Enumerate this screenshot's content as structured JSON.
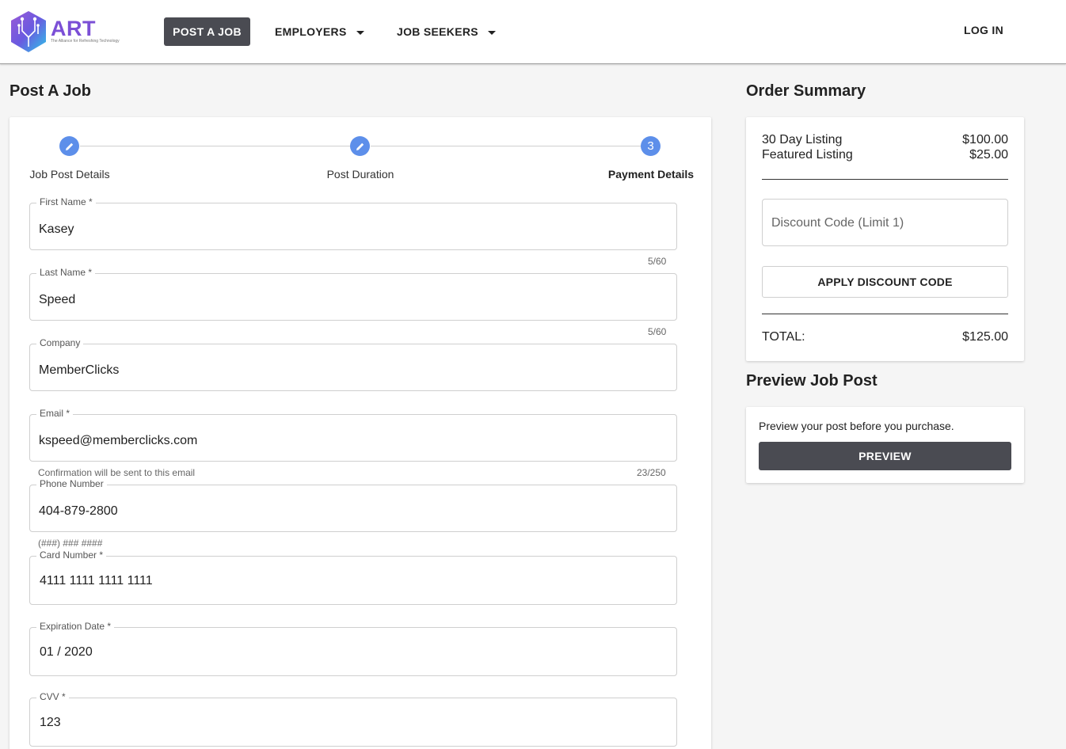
{
  "header": {
    "logo_text": "ART",
    "logo_tagline": "The Alliance for Refreshing Technology",
    "nav": {
      "post_job": "POST A JOB",
      "employers": "EMPLOYERS",
      "job_seekers": "JOB SEEKERS",
      "login": "LOG IN"
    }
  },
  "page_title": "Post A Job",
  "stepper": {
    "steps": [
      {
        "label": "Job Post Details",
        "icon": "pencil-icon"
      },
      {
        "label": "Post Duration",
        "icon": "pencil-icon"
      },
      {
        "label": "Payment Details",
        "number": "3"
      }
    ]
  },
  "form": {
    "first_name": {
      "label": "First Name  *",
      "value": "Kasey",
      "counter": "5/60"
    },
    "last_name": {
      "label": "Last Name  *",
      "value": "Speed",
      "counter": "5/60"
    },
    "company": {
      "label": "Company",
      "value": "MemberClicks"
    },
    "email": {
      "label": "Email  *",
      "value": "kspeed@memberclicks.com",
      "hint": "Confirmation will be sent to this email",
      "counter": "23/250"
    },
    "phone": {
      "label": "Phone Number",
      "value": "404-879-2800",
      "hint": "(###) ### ####"
    },
    "card_number": {
      "label": "Card Number *",
      "value": "4111 1111 1111 1111"
    },
    "expiration": {
      "label": "Expiration Date *",
      "value": "01 / 2020"
    },
    "cvv": {
      "label": "CVV *",
      "value": "123"
    }
  },
  "order_summary": {
    "title": "Order Summary",
    "items": [
      {
        "name": "30 Day Listing",
        "price": "$100.00"
      },
      {
        "name": "Featured Listing",
        "price": "$25.00"
      }
    ],
    "discount_placeholder": "Discount Code (Limit 1)",
    "apply_label": "APPLY DISCOUNT CODE",
    "total_label": "TOTAL:",
    "total_value": "$125.00"
  },
  "preview": {
    "title": "Preview Job Post",
    "text": "Preview your post before you purchase.",
    "button": "PREVIEW"
  },
  "colors": {
    "primary_button": "#4a4b52",
    "step_accent": "#5d8fea",
    "logo_purple": "#7b4fd6"
  }
}
